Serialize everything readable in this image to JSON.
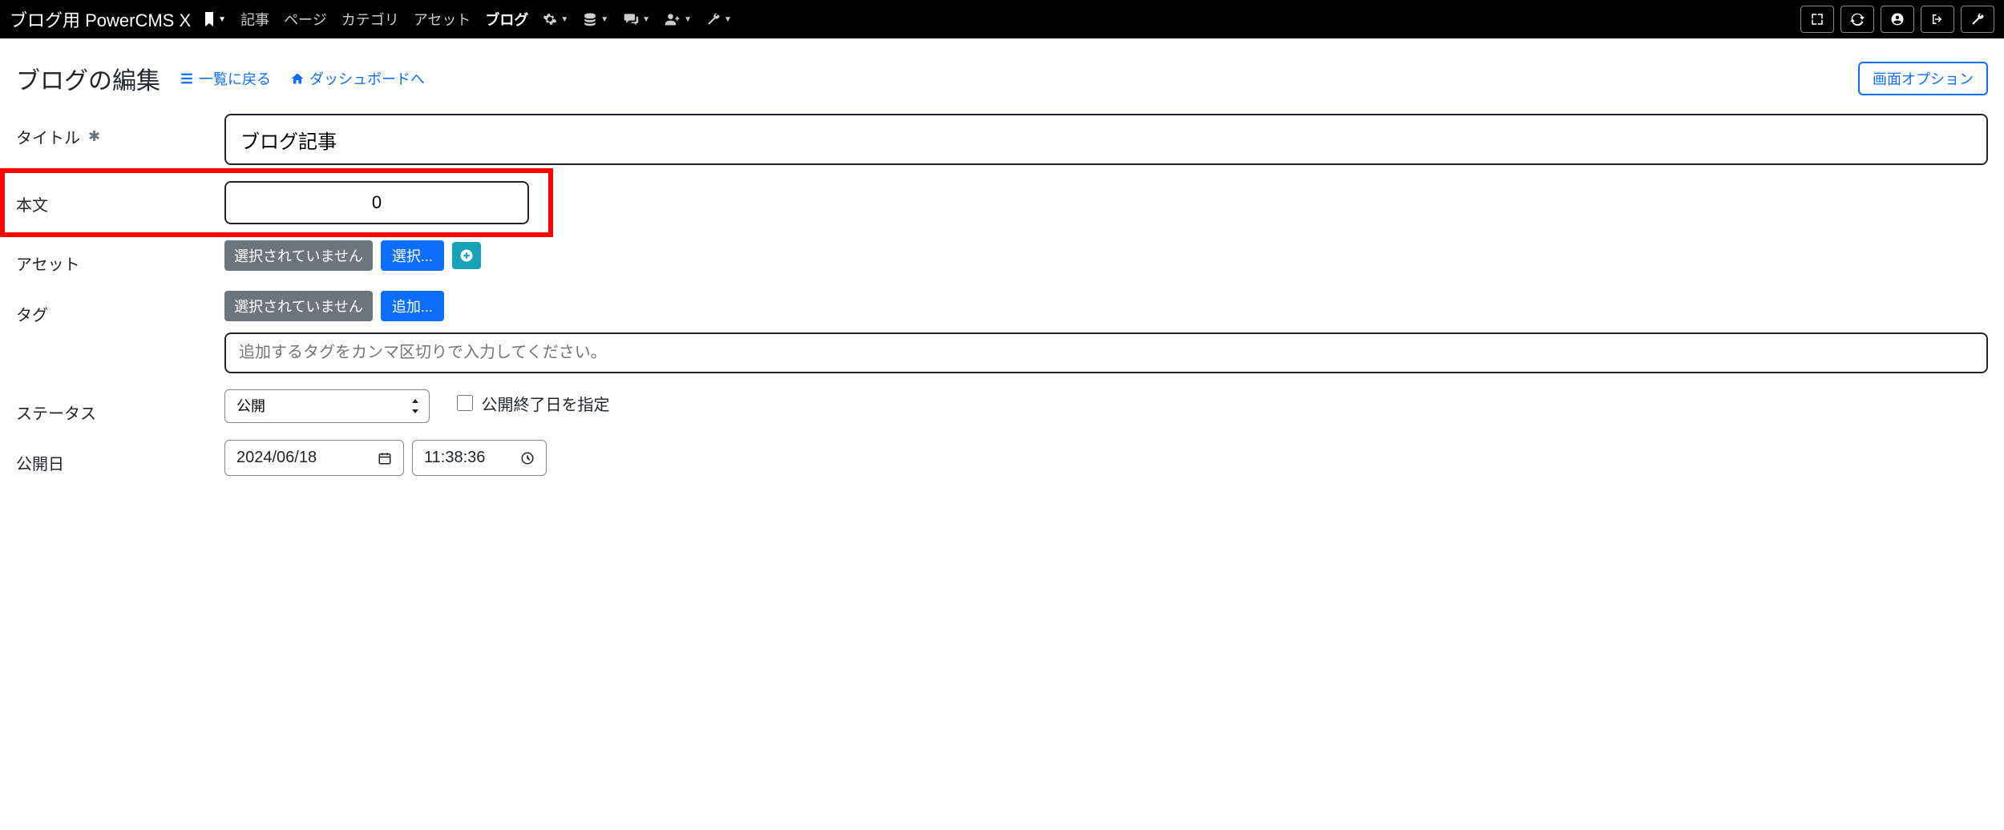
{
  "brand": "ブログ用 PowerCMS X",
  "nav": {
    "items": [
      {
        "label": "記事"
      },
      {
        "label": "ページ"
      },
      {
        "label": "カテゴリ"
      },
      {
        "label": "アセット"
      },
      {
        "label": "ブログ",
        "bold": true
      }
    ]
  },
  "header": {
    "title": "ブログの編集",
    "back_to_list": "一覧に戻る",
    "to_dashboard": "ダッシュボードへ",
    "screen_options": "画面オプション"
  },
  "form": {
    "title_label": "タイトル",
    "title_value": "ブログ記事",
    "body_label": "本文",
    "body_value": "0",
    "asset_label": "アセット",
    "asset_none": "選択されていません",
    "asset_select": "選択...",
    "tag_label": "タグ",
    "tag_none": "選択されていません",
    "tag_add": "追加...",
    "tag_placeholder": "追加するタグをカンマ区切りで入力してください。",
    "status_label": "ステータス",
    "status_value": "公開",
    "status_end_checkbox": "公開終了日を指定",
    "publish_label": "公開日",
    "publish_date": "2024/06/18",
    "publish_time": "11:38:36"
  }
}
